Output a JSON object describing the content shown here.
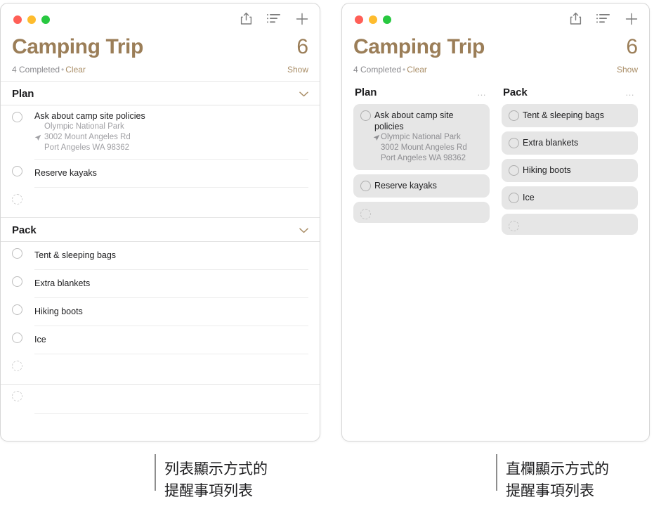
{
  "windows": {
    "list_view": {
      "traffic_lights": {
        "close": "close-button",
        "minimize": "minimize-button",
        "maximize": "maximize-button"
      },
      "toolbar": {
        "share": "share-icon",
        "view_options": "list-view-icon",
        "add": "plus-icon"
      },
      "header": {
        "title": "Camping Trip",
        "count": "6",
        "completed": "4 Completed",
        "separator": "•",
        "clear": "Clear",
        "show": "Show"
      },
      "sections": [
        {
          "name": "Plan",
          "items": [
            {
              "title": "Ask about camp site policies",
              "sub": [
                "Olympic National Park",
                "3002 Mount Angeles Rd",
                "Port Angeles WA 98362"
              ],
              "arrow_line": 1
            },
            {
              "title": "Reserve kayaks",
              "sub": [],
              "arrow_line": -1
            },
            {
              "title": "",
              "sub": [],
              "arrow_line": -1,
              "empty": true
            }
          ]
        },
        {
          "name": "Pack",
          "items": [
            {
              "title": "Tent & sleeping bags",
              "sub": [],
              "arrow_line": -1
            },
            {
              "title": "Extra blankets",
              "sub": [],
              "arrow_line": -1
            },
            {
              "title": "Hiking boots",
              "sub": [],
              "arrow_line": -1
            },
            {
              "title": "Ice",
              "sub": [],
              "arrow_line": -1
            },
            {
              "title": "",
              "sub": [],
              "arrow_line": -1,
              "empty": true
            }
          ]
        }
      ],
      "trailing_empty_row": {
        "title": "",
        "empty": true
      }
    },
    "column_view": {
      "toolbar": {
        "share": "share-icon",
        "view_options": "list-view-icon",
        "add": "plus-icon"
      },
      "header": {
        "title": "Camping Trip",
        "count": "6",
        "completed": "4 Completed",
        "separator": "•",
        "clear": "Clear",
        "show": "Show"
      },
      "columns": [
        {
          "name": "Plan",
          "menu": "…",
          "cards": [
            {
              "title": "Ask about camp site policies",
              "sub": [
                "Olympic National Park",
                "3002 Mount Angeles Rd",
                "Port Angeles WA 98362"
              ]
            },
            {
              "title": "Reserve kayaks",
              "sub": []
            },
            {
              "title": "",
              "sub": [],
              "empty": true
            }
          ]
        },
        {
          "name": "Pack",
          "menu": "…",
          "cards": [
            {
              "title": "Tent & sleeping bags",
              "sub": []
            },
            {
              "title": "Extra blankets",
              "sub": []
            },
            {
              "title": "Hiking boots",
              "sub": []
            },
            {
              "title": "Ice",
              "sub": []
            },
            {
              "title": "",
              "sub": [],
              "empty": true
            }
          ]
        }
      ]
    }
  },
  "callouts": {
    "list_view": {
      "line1": "列表顯示方式的",
      "line2": "提醒事項列表"
    },
    "column_view": {
      "line1": "直欄顯示方式的",
      "line2": "提醒事項列表"
    }
  },
  "colors": {
    "accent_brown": "#9b7e58",
    "link_brown": "#a98d66",
    "card_gray": "#e6e6e6",
    "traffic_red": "#ff5f57",
    "traffic_yellow": "#febc2e",
    "traffic_green": "#28c840"
  }
}
